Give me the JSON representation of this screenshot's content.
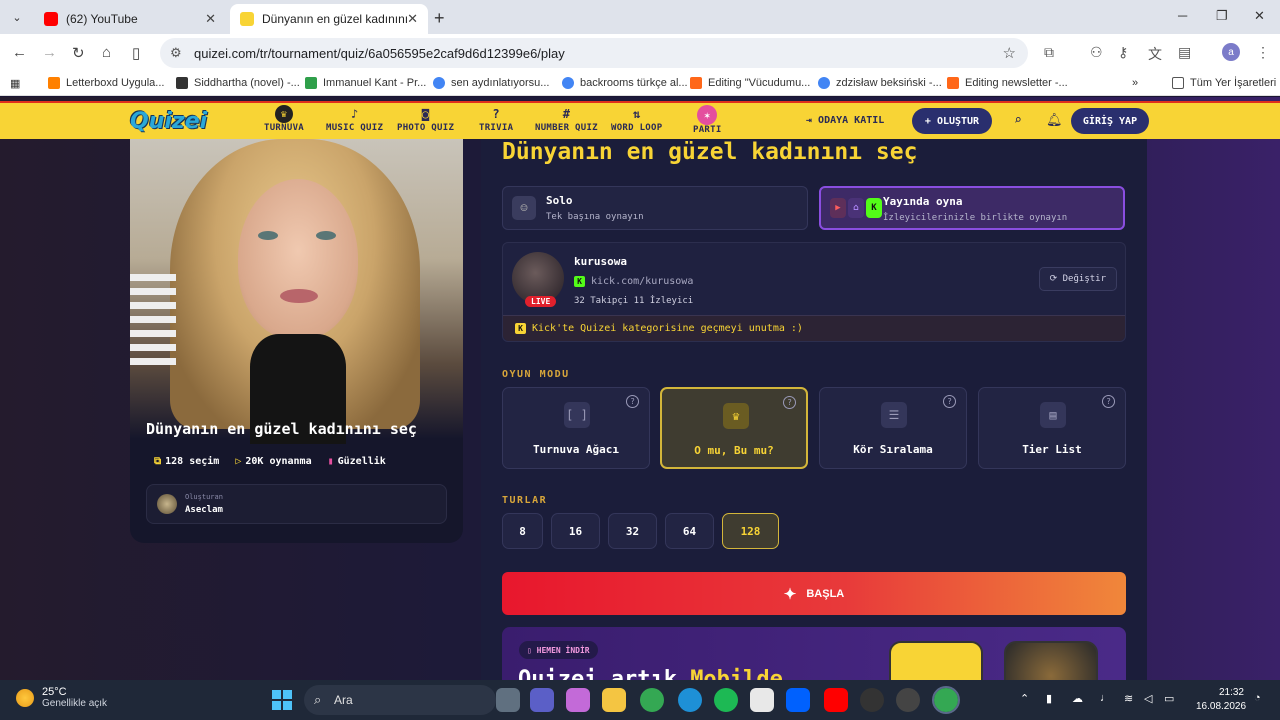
{
  "browser": {
    "tabs": [
      {
        "title": "(62) YouTube",
        "favicon_color": "#ff0000"
      },
      {
        "title": "Dünyanın en güzel kadınını seç",
        "favicon_color": "#f8d435"
      }
    ],
    "url": "quizei.com/tr/tournament/quiz/6a056595e2caf9d6d12399e6/play",
    "profile_initial": "a",
    "bookmarks": [
      {
        "label": "Letterboxd Uygula...",
        "color": "#ff8000"
      },
      {
        "label": "Siddhartha (novel) -...",
        "color": "#333333"
      },
      {
        "label": "Immanuel Kant - Pr...",
        "color": "#2f9f4a"
      },
      {
        "label": "sen aydınlatıyorsu...",
        "color": "#4285f4"
      },
      {
        "label": "backrooms türkçe al...",
        "color": "#4285f4"
      },
      {
        "label": "Editing \"Vücudumu...",
        "color": "#ff6719"
      },
      {
        "label": "zdzisław beksiński -...",
        "color": "#4285f4"
      },
      {
        "label": "Editing newsletter -...",
        "color": "#ff6719"
      }
    ],
    "other_bookmarks": "Tüm Yer İşaretleri"
  },
  "site": {
    "logo": "Quizei",
    "nav": [
      {
        "label": "TURNUVA",
        "icon": "trophy-icon"
      },
      {
        "label": "MUSIC QUIZ",
        "icon": "music-note-icon"
      },
      {
        "label": "PHOTO QUIZ",
        "icon": "camera-icon"
      },
      {
        "label": "TRIVIA",
        "icon": "question-icon"
      },
      {
        "label": "NUMBER QUIZ",
        "icon": "hash-icon"
      },
      {
        "label": "WORD LOOP",
        "icon": "sort-icon"
      },
      {
        "label": "PARTI",
        "icon": "party-icon"
      }
    ],
    "join_room": "ODAYA KATIL",
    "create": "OLUŞTUR",
    "login": "GİRİŞ YAP"
  },
  "quiz_card": {
    "title": "Dünyanın en güzel kadınını seç",
    "choices": "128 seçim",
    "plays": "20K oynanma",
    "category": "Güzellik",
    "creator_label": "Oluşturan",
    "creator_name": "Aseclam"
  },
  "main": {
    "title": "Dünyanın en güzel kadınını seç",
    "play_modes": [
      {
        "title": "Solo",
        "subtitle": "Tek başına oynayın"
      },
      {
        "title": "Yayında oyna",
        "subtitle": "İzleyicilerinizle birlikte oynayın"
      }
    ],
    "streamer": {
      "name": "kurusowa",
      "url": "kick.com/kurusowa",
      "stats": "32 Takipçi  11 İzleyici",
      "live_badge": "LIVE",
      "change_label": "Değiştir",
      "note": "Kick'te Quizei kategorisine geçmeyi unutma :)"
    },
    "game_mode_label": "OYUN MODU",
    "game_modes": [
      {
        "label": "Turnuva Ağacı",
        "icon": "bracket-icon"
      },
      {
        "label": "O mu, Bu mu?",
        "icon": "crown-icon"
      },
      {
        "label": "Kör Sıralama",
        "icon": "list-ordered-icon"
      },
      {
        "label": "Tier List",
        "icon": "tier-list-icon"
      }
    ],
    "selected_game_mode": "O mu, Bu mu?",
    "rounds_label": "TURLAR",
    "rounds": [
      "8",
      "16",
      "32",
      "64",
      "128"
    ],
    "selected_round": "128",
    "start_label": "BAŞLA",
    "promo_tag": "HEMEN İNDİR",
    "promo_title_a": "Quizei artık ",
    "promo_title_b": "Mobilde"
  },
  "taskbar": {
    "temperature": "25°C",
    "weather": "Genellikle açık",
    "search": "Ara",
    "time": "21:32",
    "date": "16.08.2026"
  }
}
